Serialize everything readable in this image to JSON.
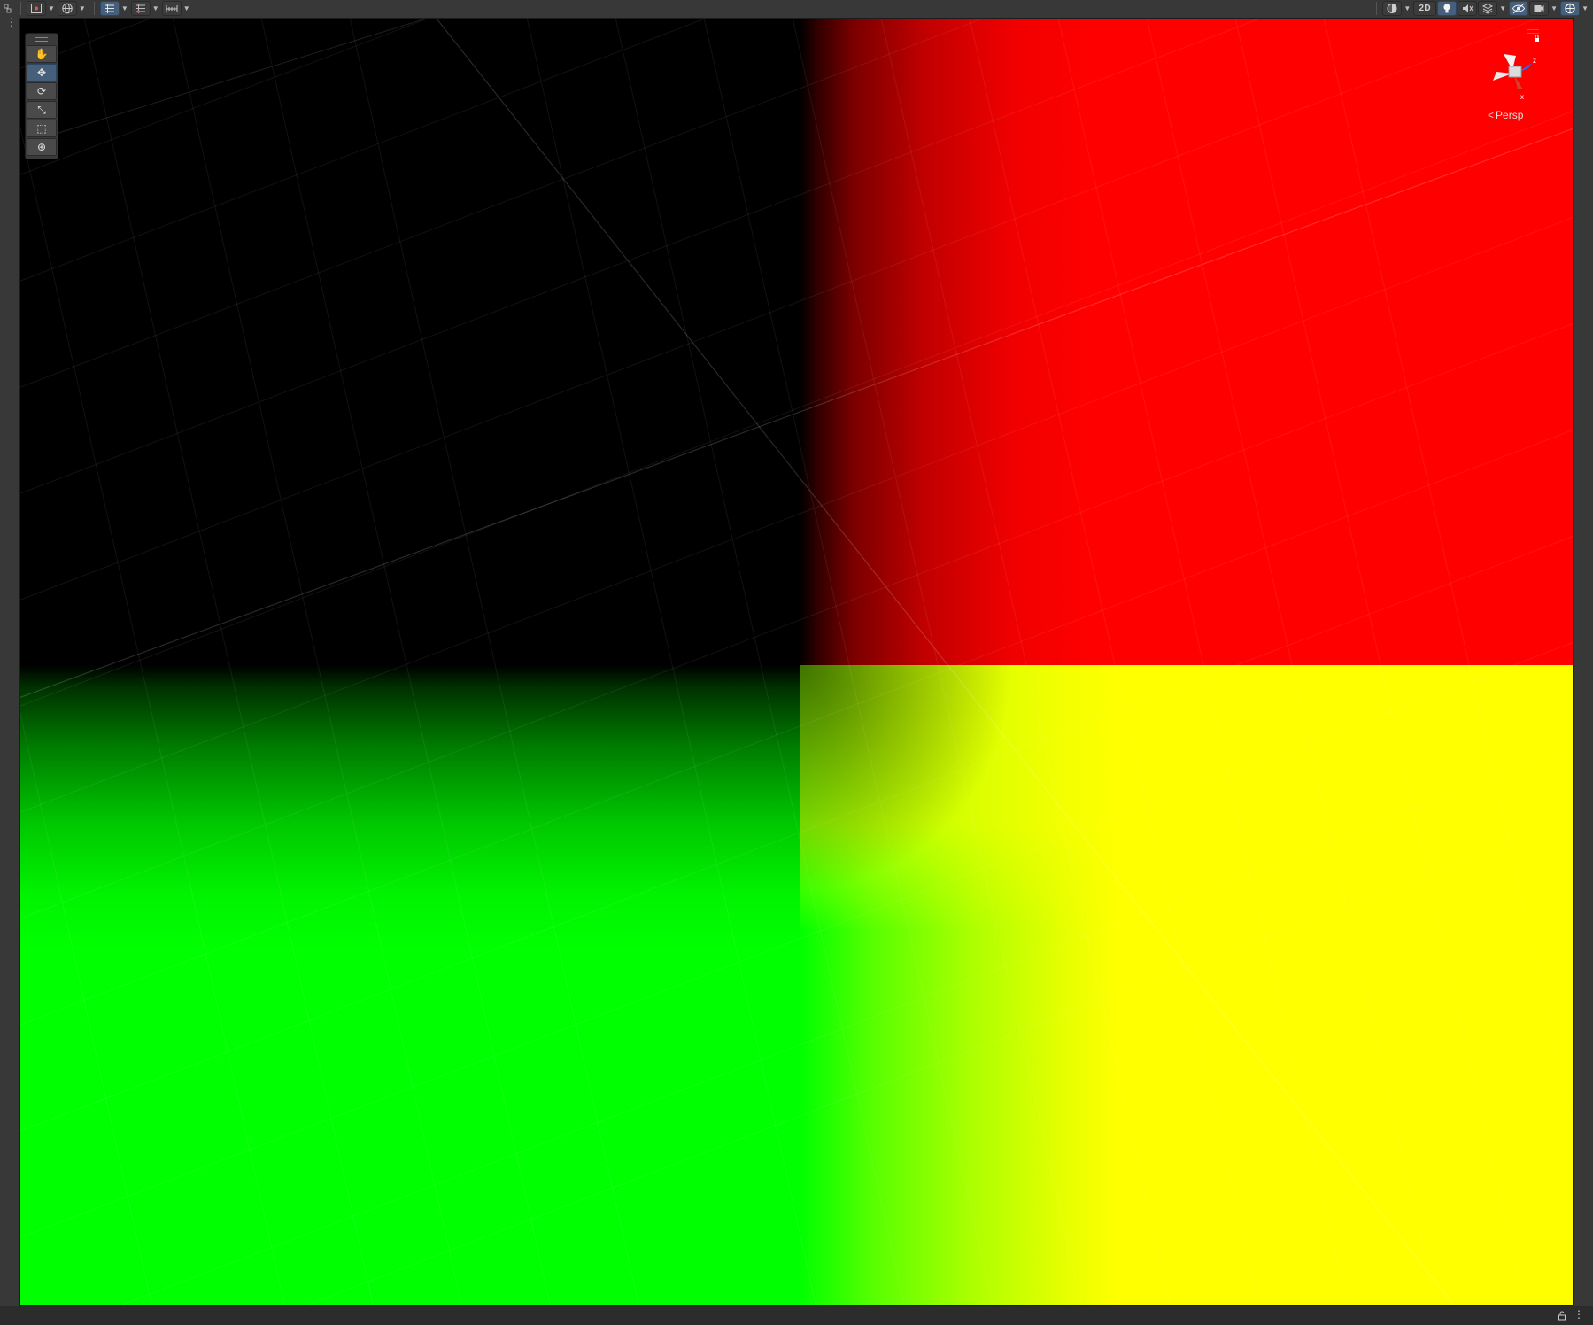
{
  "toolbar": {
    "left_buttons": [
      {
        "name": "tool-handle-position",
        "icon": "gizmo-pivot-icon",
        "has_menu": true
      },
      {
        "name": "tool-handle-rotation",
        "icon": "globe-icon",
        "has_menu": true
      },
      {
        "name": "grid-visibility",
        "icon": "grid-toggle-icon",
        "has_menu": true,
        "active": true
      },
      {
        "name": "grid-snapping",
        "icon": "grid-snap-icon",
        "has_menu": true
      },
      {
        "name": "increment-snap",
        "icon": "ruler-icon",
        "has_menu": true
      }
    ],
    "right_buttons": [
      {
        "name": "draw-mode",
        "icon": "shading-sphere-icon",
        "has_menu": true
      },
      {
        "name": "toggle-2d",
        "label": "2D"
      },
      {
        "name": "toggle-lighting",
        "icon": "lightbulb-icon",
        "active": true
      },
      {
        "name": "toggle-audio",
        "icon": "audio-icon"
      },
      {
        "name": "toggle-effects",
        "icon": "layers-effects-icon",
        "has_menu": true
      },
      {
        "name": "scene-visibility",
        "icon": "eye-hidden-icon",
        "active": true
      },
      {
        "name": "camera-settings",
        "icon": "camera-icon",
        "has_menu": true
      },
      {
        "name": "gizmos",
        "icon": "gizmo-globe-icon",
        "active": true,
        "has_menu": true
      }
    ]
  },
  "scene": {
    "quadrant_colors": {
      "top_left": "#000000",
      "top_right": "#ff0000",
      "bottom_left": "#00ff00",
      "bottom_right": "#ffff00"
    }
  },
  "tools": [
    {
      "name": "view-tool",
      "icon": "hand-icon",
      "glyph": "✋"
    },
    {
      "name": "move-tool",
      "icon": "move-arrows-icon",
      "glyph": "✥",
      "active": true
    },
    {
      "name": "rotate-tool",
      "icon": "rotate-icon",
      "glyph": "⟳"
    },
    {
      "name": "scale-tool",
      "icon": "scale-icon",
      "glyph": "⤡"
    },
    {
      "name": "rect-tool",
      "icon": "rect-transform-icon",
      "glyph": "⬚"
    },
    {
      "name": "transform-tool",
      "icon": "transform-icon",
      "glyph": "⊕"
    }
  ],
  "gizmo": {
    "projection_label": "Persp",
    "axis_labels": {
      "x": "x",
      "z": "z"
    }
  },
  "statusbar": {
    "lock_icon": "lock-icon",
    "more_icon": "kebab-icon"
  }
}
